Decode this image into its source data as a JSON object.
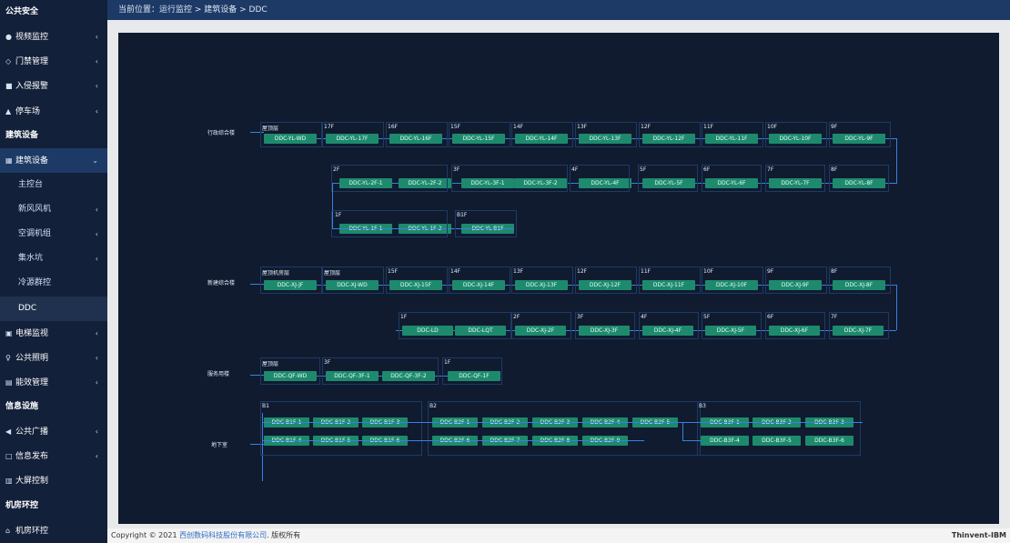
{
  "sidebar": {
    "items": [
      {
        "label": "公共安全",
        "kind": "section",
        "icon": ""
      },
      {
        "label": "视频监控",
        "kind": "item",
        "icon": "●",
        "arrow": "‹"
      },
      {
        "label": "门禁管理",
        "kind": "item",
        "icon": "◇",
        "arrow": "‹"
      },
      {
        "label": "入侵报警",
        "kind": "item",
        "icon": "■",
        "arrow": "‹"
      },
      {
        "label": "停车场",
        "kind": "item",
        "icon": "▲",
        "arrow": "‹"
      },
      {
        "label": "建筑设备",
        "kind": "section",
        "icon": ""
      },
      {
        "label": "建筑设备",
        "kind": "active",
        "icon": "▦",
        "arrow": "⌄"
      },
      {
        "label": "主控台",
        "kind": "sub",
        "icon": "",
        "arrow": ""
      },
      {
        "label": "新风风机",
        "kind": "sub",
        "icon": "",
        "arrow": "‹"
      },
      {
        "label": "空调机组",
        "kind": "sub",
        "icon": "",
        "arrow": "‹"
      },
      {
        "label": "集水坑",
        "kind": "sub",
        "icon": "",
        "arrow": "‹"
      },
      {
        "label": "冷源群控",
        "kind": "sub",
        "icon": "",
        "arrow": ""
      },
      {
        "label": "DDC",
        "kind": "current",
        "icon": "",
        "arrow": ""
      },
      {
        "label": "电梯监视",
        "kind": "item",
        "icon": "▣",
        "arrow": "‹"
      },
      {
        "label": "公共照明",
        "kind": "item",
        "icon": "♀",
        "arrow": "‹"
      },
      {
        "label": "能效管理",
        "kind": "item",
        "icon": "▤",
        "arrow": "‹"
      },
      {
        "label": "信息设施",
        "kind": "section",
        "icon": ""
      },
      {
        "label": "公共广播",
        "kind": "item",
        "icon": "◀",
        "arrow": "‹"
      },
      {
        "label": "信息发布",
        "kind": "item",
        "icon": "□",
        "arrow": "‹"
      },
      {
        "label": "大屏控制",
        "kind": "item",
        "icon": "▥",
        "arrow": ""
      },
      {
        "label": "机房环控",
        "kind": "section",
        "icon": ""
      },
      {
        "label": "机房环控",
        "kind": "item",
        "icon": "⌂",
        "arrow": ""
      }
    ]
  },
  "breadcrumb": "当前位置：运行监控 > 建筑设备 > DDC",
  "footer": {
    "copyright_prefix": "Copyright © 2021 ",
    "company": "西创数码科技股份有限公司",
    "rights": ". 版权所有",
    "brand": "Thinvent-IBM"
  },
  "groups": {
    "g1": {
      "label": "行政综合楼"
    },
    "g2": {
      "label": "新建综合楼"
    },
    "g3": {
      "label": "服务用楼"
    },
    "g4": {
      "label": "地下室"
    }
  },
  "floors": {
    "g1r1": [
      "屋顶层",
      "17F",
      "16F",
      "15F",
      "14F",
      "13F",
      "12F",
      "11F",
      "10F",
      "9F"
    ],
    "g1r2": [
      "2F",
      "3F",
      "4F",
      "5F",
      "6F",
      "7F",
      "8F"
    ],
    "g1r3": [
      "1F",
      "B1F"
    ],
    "g2r1": [
      "屋顶机房层",
      "屋顶层",
      "15F",
      "14F",
      "13F",
      "12F",
      "11F",
      "10F",
      "9F",
      "8F"
    ],
    "g2r2": [
      "1F",
      "2F",
      "3F",
      "4F",
      "5F",
      "6F",
      "7F"
    ],
    "g3r1": [
      "屋顶层",
      "3F",
      "1F"
    ],
    "g4": [
      "B1",
      "B2",
      "B3"
    ]
  },
  "nodes": {
    "g1r1": [
      "DDC-YL-WD",
      "DDC-YL-17F",
      "DDC-YL-16F",
      "DDC-YL-15F",
      "DDC-YL-14F",
      "DDC-YL-13F",
      "DDC-YL-12F",
      "DDC-YL-11F",
      "DDC-YL-10F",
      "DDC-YL-9F"
    ],
    "g1r2": [
      "DDC-YL-2F-1",
      "DDC-YL-2F-2",
      "DDC-YL-3F-1",
      "DDC-YL-3F-2",
      "DDC-YL-4F",
      "DDC-YL-5F",
      "DDC-YL-6F",
      "DDC-YL-7F",
      "DDC-YL-8F"
    ],
    "g1r3": [
      "DDC-YL-1F-1",
      "DDC-YL-1F-2",
      "DDC-YL-B1F"
    ],
    "g2r1": [
      "DDC-XJ-JF",
      "DDC-XJ-WD",
      "DDC-XJ-15F",
      "DDC-XJ-14F",
      "DDC-XJ-13F",
      "DDC-XJ-12F",
      "DDC-XJ-11F",
      "DDC-XJ-10F",
      "DDC-XJ-9F",
      "DDC-XJ-8F"
    ],
    "g2r2": [
      "DDC-LD",
      "DDC-LQT",
      "DDC-XJ-2F",
      "DDC-XJ-3F",
      "DDC-XJ-4F",
      "DDC-XJ-5F",
      "DDC-XJ-6F",
      "DDC-XJ-7F"
    ],
    "g3": [
      "DDC-QF-WD",
      "DDC-QF-3F-1",
      "DDC-QF-3F-2",
      "DDC-QF-1F"
    ],
    "g4r1": [
      "DDC-B1F-1",
      "DDC-B1F-2",
      "DDC-B1F-3",
      "DDC-B2F-1",
      "DDC-B2F-2",
      "DDC-B2F-3",
      "DDC-B2F-4",
      "DDC-B2F-5",
      "DDC-B3F-1",
      "DDC-B3F-2",
      "DDC-B3F-3"
    ],
    "g4r2": [
      "DDC-B1F-4",
      "DDC-B1F-5",
      "DDC-B1F-6",
      "DDC-B2F-6",
      "DDC-B2F-7",
      "DDC-B2F-8",
      "DDC-B2F-9",
      "DDC-B3F-4",
      "DDC-B3F-5",
      "DDC-B3F-6"
    ]
  },
  "colors": {
    "node": "#1e8a6d",
    "line": "#3a7fe0",
    "canvas": "#101b30",
    "sidebar": "#13203a",
    "topbar": "#1d3a66"
  }
}
